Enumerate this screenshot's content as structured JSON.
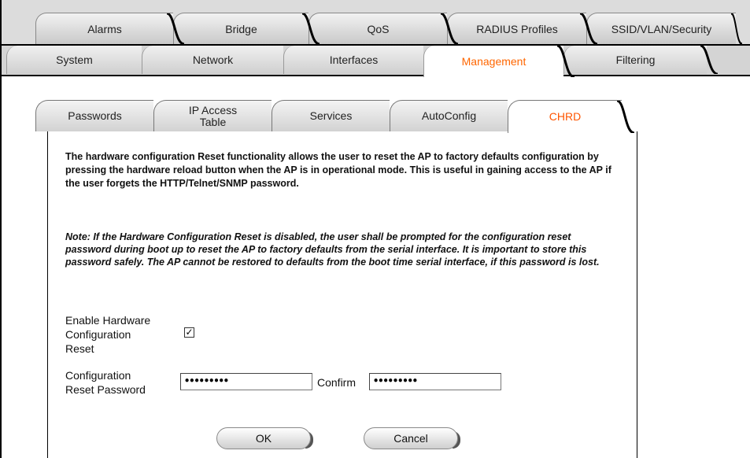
{
  "top_tabs": [
    "Alarms",
    "Bridge",
    "QoS",
    "RADIUS Profiles",
    "SSID/VLAN/Security"
  ],
  "main_tabs": [
    "System",
    "Network",
    "Interfaces",
    "Management",
    "Filtering"
  ],
  "main_tabs_active": "Management",
  "sub_tabs": {
    "passwords": "Passwords",
    "ip_access_line1": "IP Access",
    "ip_access_line2": "Table",
    "services": "Services",
    "autoconfig": "AutoConfig",
    "chrd": "CHRD"
  },
  "sub_tabs_active": "CHRD",
  "intro_text": "The hardware configuration Reset functionality allows the user to reset the AP to factory defaults configuration by pressing the hardware reload button when the AP is in operational mode. This is useful in gaining access to the AP if the user forgets the HTTP/Telnet/SNMP password.",
  "note_text": "Note: If the Hardware Configuration Reset is disabled, the user shall be prompted for the configuration reset password during boot up to reset the AP to factory defaults from the serial interface. It is important to store this password safely. The AP cannot be restored to defaults from the boot time serial interface, if this password is lost.",
  "form": {
    "enable_label_l1": "Enable Hardware",
    "enable_label_l2": "Configuration",
    "enable_label_l3": "Reset",
    "enable_checked": true,
    "password_label_l1": "Configuration",
    "password_label_l2": "Reset Password",
    "password_value": "•••••••••",
    "confirm_label": "Confirm",
    "confirm_value": "•••••••••"
  },
  "buttons": {
    "ok": "OK",
    "cancel": "Cancel"
  },
  "colors": {
    "active_tab_text": "#ff6600",
    "tab_bg": "#d4d4d4"
  }
}
